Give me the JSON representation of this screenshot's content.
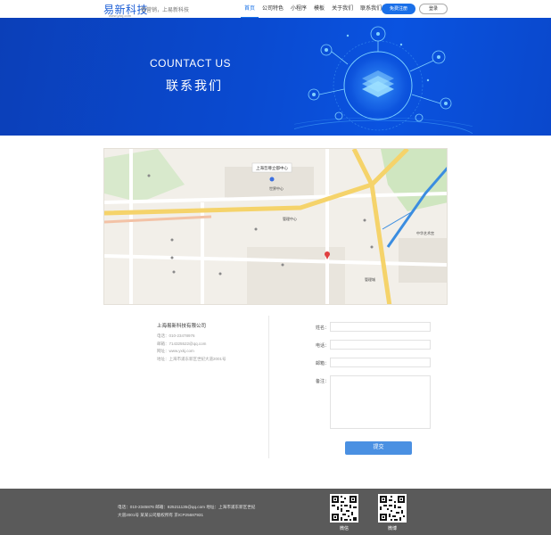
{
  "header": {
    "logo_text": "易新科技",
    "logo_url": "www.yxkj.com",
    "slogan": "做营销，上易新科技",
    "nav": [
      "首页",
      "公司特色",
      "小程序",
      "模板",
      "关于我们",
      "联系我们"
    ],
    "active_nav": "首页",
    "register_label": "免费注册",
    "login_label": "登录"
  },
  "banner": {
    "title_en": "COUNTACT   US",
    "title_cn": "联系我们"
  },
  "map": {
    "callout": "上海哲尊立都中心",
    "labels": [
      "世界中心",
      "管理中心",
      "中华艺术宫",
      "管理城"
    ],
    "colors": {
      "road": "#ffffff",
      "major_road": "#f5d36a",
      "park": "#cfe6c0",
      "metro": "#3b8de0"
    }
  },
  "company": {
    "name": "上海易新科技有限公司",
    "lines": [
      "电话：010-23478976",
      "邮箱：714325522@qq.com",
      "网址：www.yxkj.com",
      "地址：上海市浦东新区世纪大道2001号"
    ]
  },
  "form": {
    "fields": [
      "姓名：",
      "电话：",
      "邮箱：",
      "备注："
    ],
    "submit_label": "提交"
  },
  "footer": {
    "line1": "电话：010-2345876    邮箱：825211135@qq.com    地址：上海市浦东新区世纪",
    "line2": "大道2001号 某某公司版权所有  京ICP25687931",
    "qr_labels": [
      "微信",
      "微博"
    ]
  },
  "colors": {
    "accent": "#1a6fe8",
    "banner_blue": "#0a4ad0",
    "footer_bg": "#5a5a5a",
    "submit": "#4a90e2"
  }
}
